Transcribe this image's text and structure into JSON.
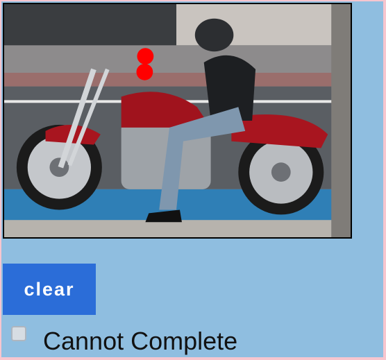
{
  "photo": {
    "subject_icon": "motorcycle-rider-photo",
    "marker_color": "#ff0000"
  },
  "controls": {
    "clear_label": "clear",
    "cannot_complete_label": "Cannot Complete",
    "cannot_complete_checked": false
  },
  "colors": {
    "background": "#8fbee0",
    "border": "#f7c6cf",
    "button": "#2b6dd8"
  }
}
